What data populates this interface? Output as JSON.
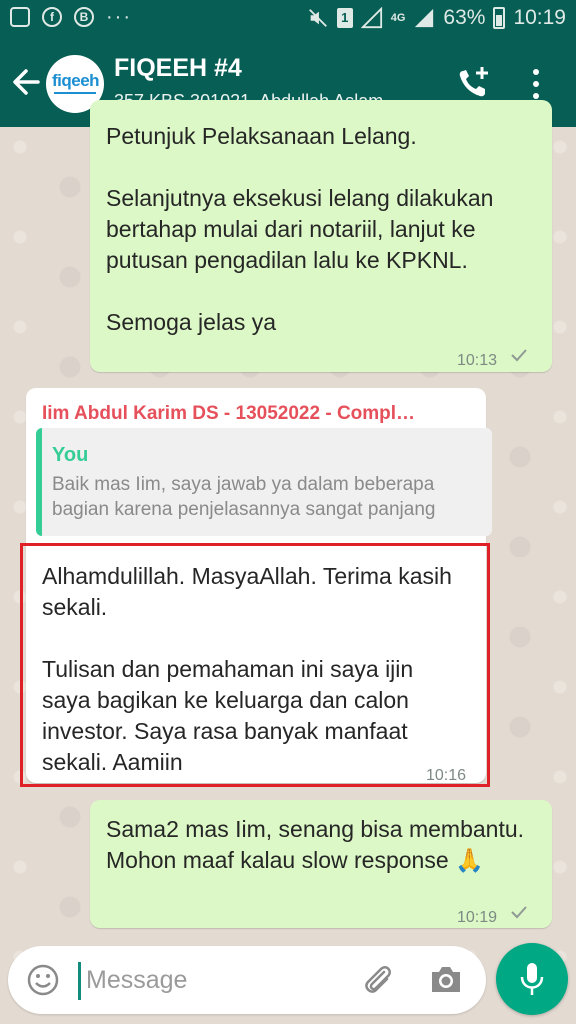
{
  "status_bar": {
    "battery": "63%",
    "time": "10:19",
    "sim_label": "1",
    "network": "4G",
    "dots": "···"
  },
  "chat": {
    "avatar_text": "fiqeeh",
    "title": "FIQEEH #4",
    "subtitle": "357 KBS 301021, Abdullah Aslam…"
  },
  "messages": [
    {
      "type": "outgoing",
      "text": "Petunjuk Pelaksanaan Lelang.\n\nSelanjutnya eksekusi lelang dilakukan bertahap mulai dari notariil, lanjut ke putusan pengadilan lalu ke KPKNL.\n\nSemoga jelas ya",
      "time": "10:13"
    },
    {
      "type": "incoming",
      "sender": "Iim Abdul Karim DS - 13052022 - Compl…",
      "quote_author": "You",
      "quote_text": "Baik mas Iim, saya jawab ya dalam beberapa bagian karena penjelasannya sangat panjang",
      "text": "Alhamdulillah. MasyaAllah. Terima kasih sekali.\n\nTulisan dan pemahaman ini saya ijin saya bagikan ke keluarga dan calon investor. Saya rasa banyak manfaat sekali. Aamiin",
      "time": "10:16"
    },
    {
      "type": "outgoing",
      "text": "Sama2 mas Iim, senang bisa membantu. Mohon maaf kalau slow response 🙏",
      "time": "10:19"
    }
  ],
  "composer": {
    "placeholder": "Message"
  },
  "colors": {
    "header": "#075e54",
    "outgoing_bubble": "#dcf8c6",
    "incoming_bubble": "#ffffff",
    "sender_name": "#e5505b",
    "quote_accent": "#35cd96",
    "mic_button": "#00a884",
    "highlight_box": "#e02027"
  },
  "icons": [
    "image-icon",
    "facebook-icon",
    "b-icon",
    "mute-icon",
    "sim-icon",
    "signal-icon",
    "battery-icon",
    "back-arrow-icon",
    "add-call-icon",
    "menu-icon",
    "checkmark-icon",
    "emoji-icon",
    "attach-icon",
    "camera-icon",
    "mic-icon"
  ]
}
